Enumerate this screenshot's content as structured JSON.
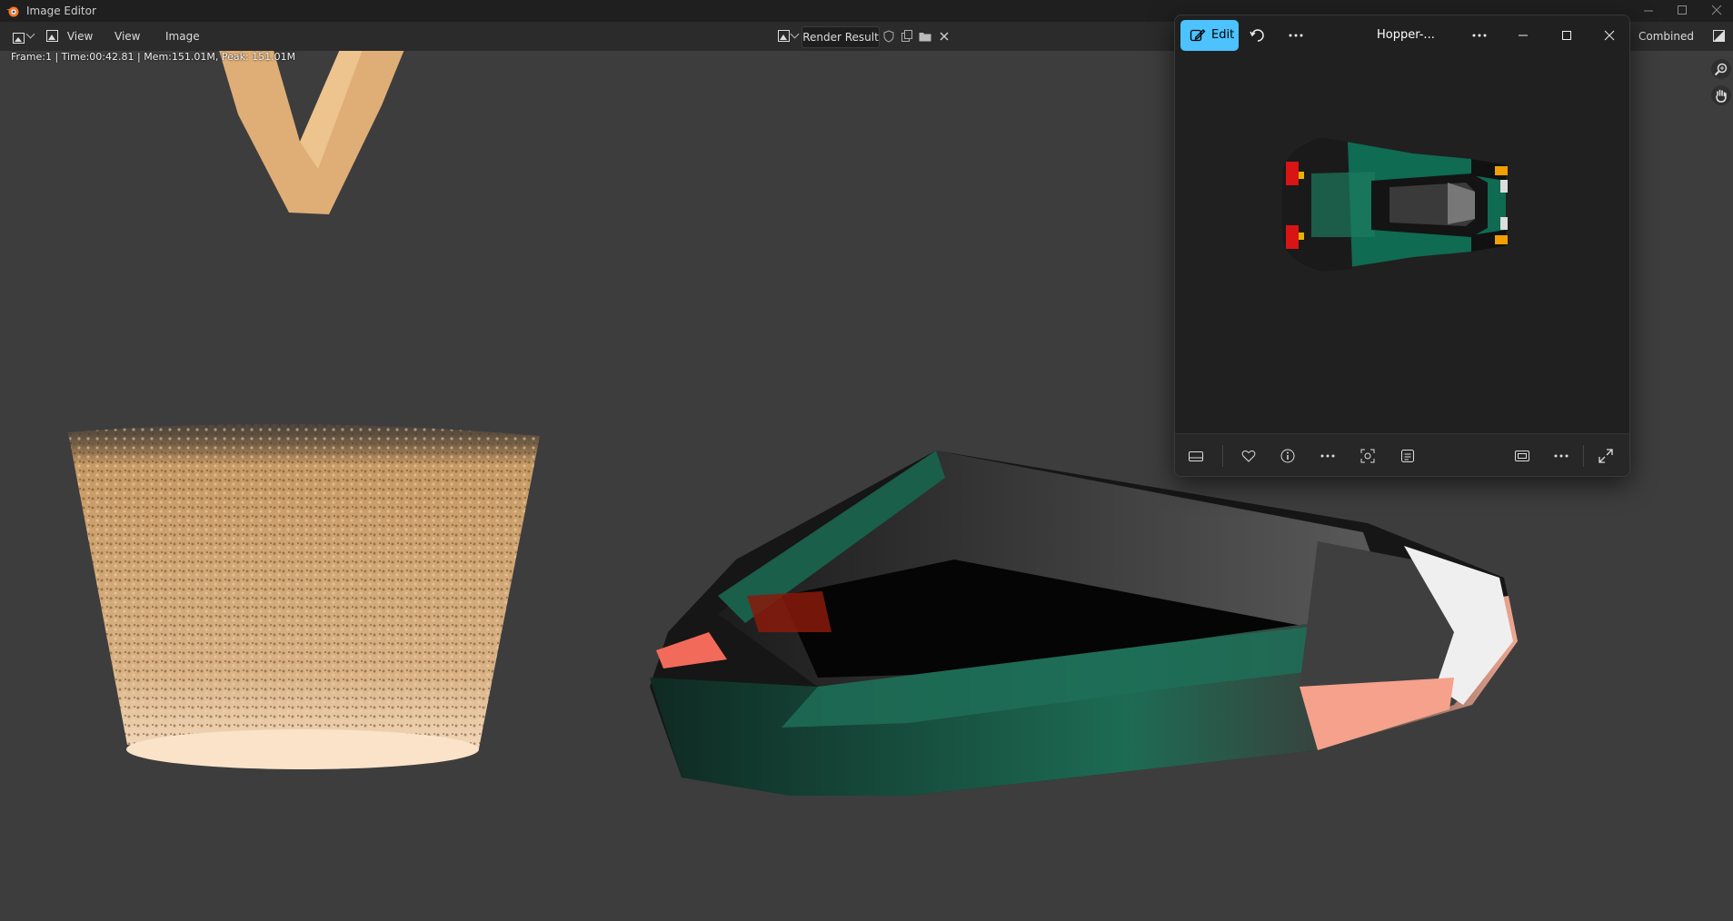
{
  "window": {
    "app_title": "Image Editor"
  },
  "header": {
    "view_dropdown": "View",
    "menus": [
      "View",
      "Image"
    ],
    "image_name": "Render Result",
    "pass_dropdown": "Combined"
  },
  "viewport": {
    "status": "Frame:1 | Time:00:42.81 | Mem:151.01M, Peak: 151.01M"
  },
  "photos": {
    "edit_label": "Edit",
    "file_title": "Hopper-..."
  },
  "colors": {
    "accent": "#4cc2ff",
    "viewport_bg": "#3d3d3d",
    "header_bg": "#2b2b2b"
  }
}
